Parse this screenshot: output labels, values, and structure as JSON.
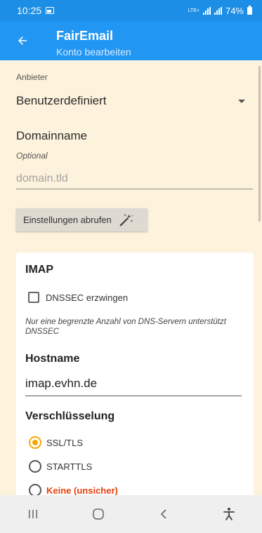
{
  "status_bar": {
    "time": "10:25",
    "network": "LTE+",
    "battery": "74%"
  },
  "app_bar": {
    "title": "FairEmail",
    "subtitle": "Konto bearbeiten"
  },
  "provider": {
    "label": "Anbieter",
    "value": "Benutzerdefiniert"
  },
  "domain": {
    "label": "Domainname",
    "hint": "Optional",
    "placeholder": "domain.tld",
    "value": ""
  },
  "fetch_settings_label": "Einstellungen abrufen",
  "imap": {
    "title": "IMAP",
    "dnssec_label": "DNSSEC erzwingen",
    "dnssec_checked": false,
    "dnssec_note": "Nur eine begrenzte Anzahl von DNS-Servern unterstützt DNSSEC",
    "hostname_label": "Hostname",
    "hostname_value": "imap.evhn.de",
    "encryption_label": "Verschlüsselung",
    "encryption_options": [
      {
        "label": "SSL/TLS",
        "selected": true
      },
      {
        "label": "STARTTLS",
        "selected": false
      },
      {
        "label": "Keine (unsicher)",
        "selected": false
      }
    ]
  },
  "colors": {
    "status_bar": "#1c8ee6",
    "app_bar": "#2196f3",
    "background": "#fdf2dc",
    "radio_accent": "#f5a700",
    "warning": "#e8400c"
  },
  "icons": {
    "back": "arrow-left-icon",
    "fetch": "magic-wand-icon",
    "dropdown": "dropdown-arrow-icon",
    "nav_recents": "recents-icon",
    "nav_home": "home-icon",
    "nav_back": "back-icon",
    "nav_accessibility": "accessibility-icon"
  }
}
